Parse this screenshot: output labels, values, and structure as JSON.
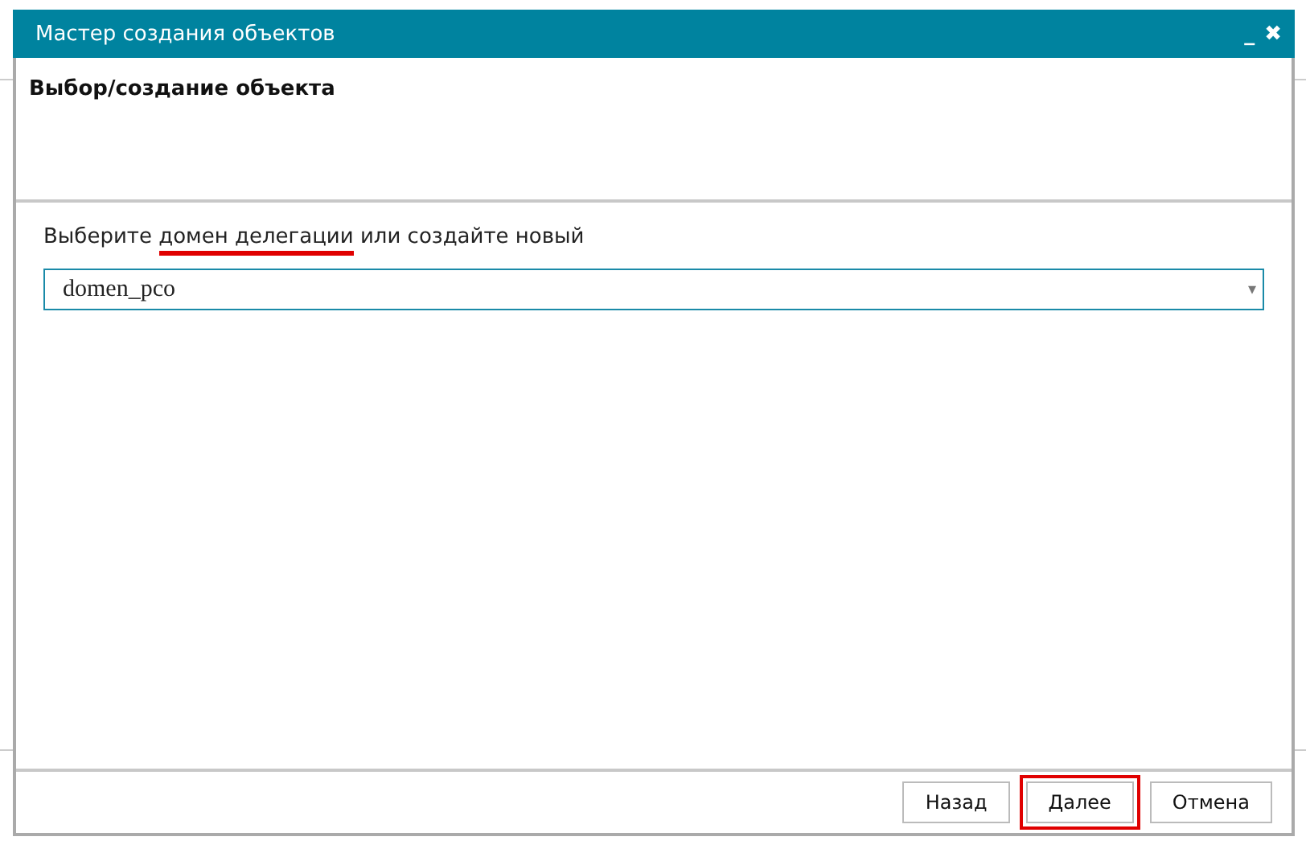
{
  "window": {
    "title": "Мастер создания объектов",
    "controls": [
      "_",
      "✖"
    ]
  },
  "step_title": "Выбор/создание объекта",
  "prompt": {
    "before": "Выберите ",
    "marked": "домен делегации",
    "after": " или создайте новый"
  },
  "select": {
    "value": "domen_pco",
    "arrow": "▾"
  },
  "buttons": [
    {
      "label": "Назад",
      "highlighted": false
    },
    {
      "label": "Далее",
      "highlighted": true
    },
    {
      "label": "Отмена",
      "highlighted": false
    }
  ]
}
